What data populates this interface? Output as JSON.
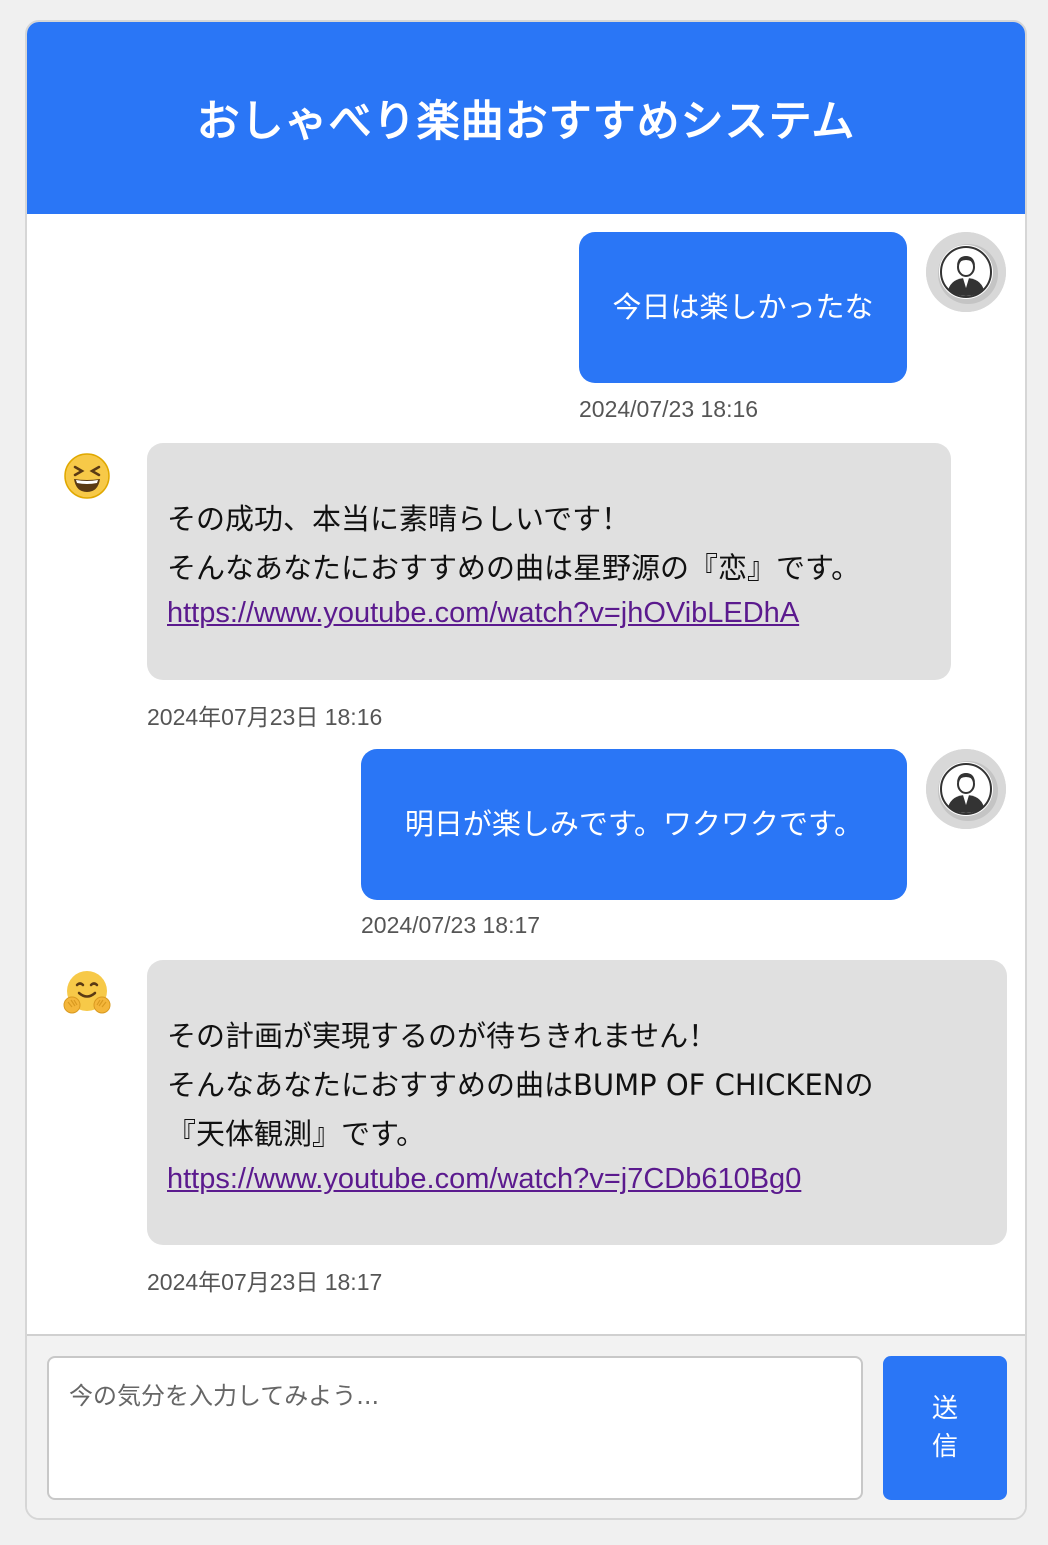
{
  "header": {
    "title": "おしゃべり楽曲おすすめシステム"
  },
  "messages": [
    {
      "role": "user",
      "text": "今日は楽しかったな",
      "time": "2024/07/23 18:16",
      "avatar_icon": "user-avatar-icon"
    },
    {
      "role": "bot",
      "emoji_icon": "grinning-squinting-face-icon",
      "lines": [
        "その成功、本当に素晴らしいです！",
        "そんなあなたにおすすめの曲は星野源の『恋』です。"
      ],
      "link": "https://www.youtube.com/watch?v=jhOVibLEDhA",
      "time": "2024年07月23日 18:16"
    },
    {
      "role": "user",
      "text": "明日が楽しみです。ワクワクです。",
      "time": "2024/07/23 18:17",
      "avatar_icon": "user-avatar-icon"
    },
    {
      "role": "bot",
      "emoji_icon": "hugging-face-icon",
      "lines": [
        "その計画が実現するのが待ちきれません！",
        "そんなあなたにおすすめの曲はBUMP OF CHICKENの",
        "『天体観測』です。"
      ],
      "link": "https://www.youtube.com/watch?v=j7CDb610Bg0",
      "time": "2024年07月23日 18:17"
    }
  ],
  "composer": {
    "placeholder": "今の気分を入力してみよう...",
    "value": "",
    "send_label": "送信"
  },
  "colors": {
    "accent": "#2a76f6",
    "bot_bubble": "#e0e0e0",
    "link": "#5b1a8e"
  }
}
